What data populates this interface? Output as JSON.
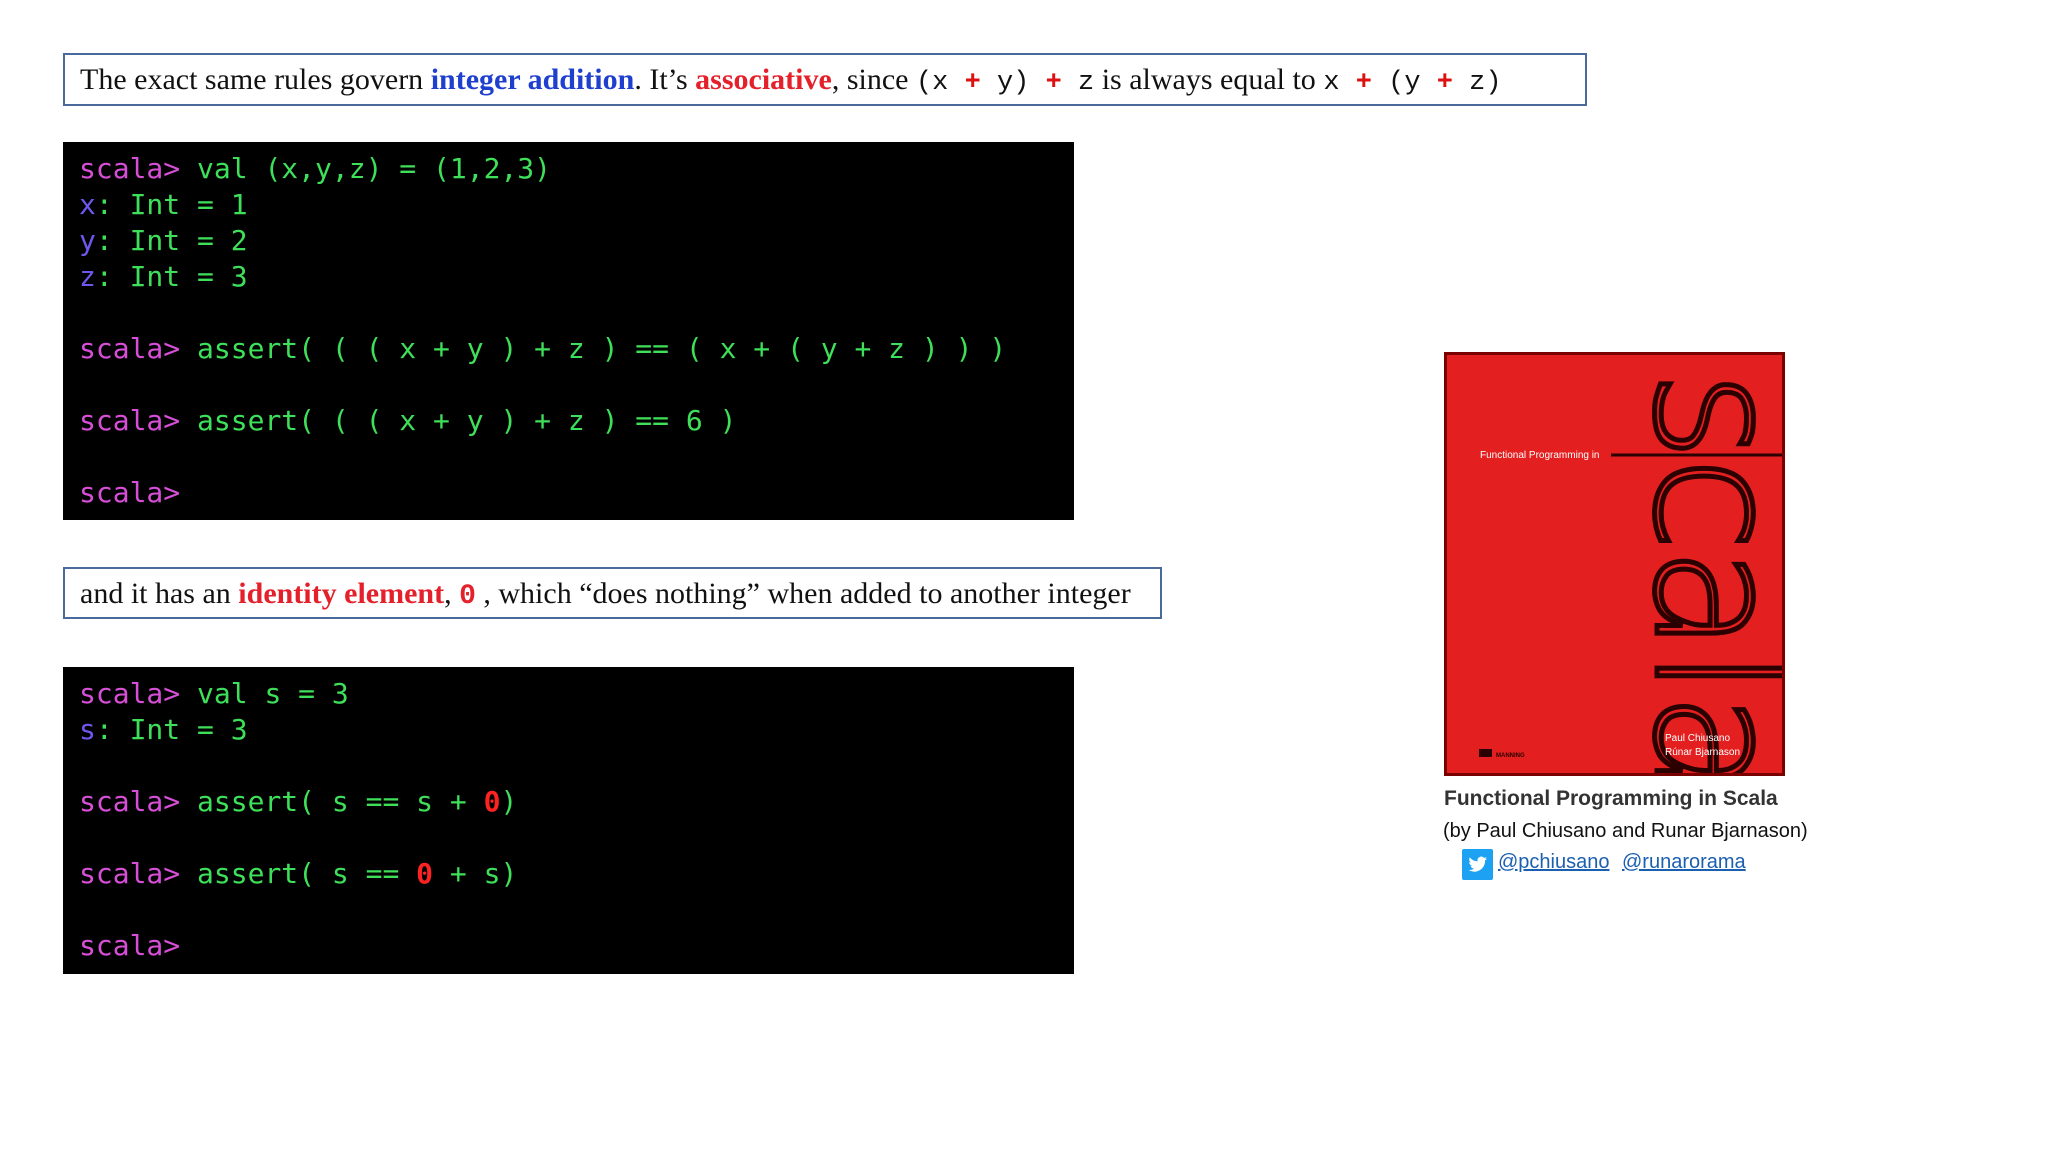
{
  "callout_associative": {
    "t1": "The exact same rules govern ",
    "integer_addition": "integer addition",
    "t2": ". It’s ",
    "associative": "associative",
    "t3": ", since ",
    "expr1_a": "(x ",
    "plus": "+",
    "expr1_b": " y) ",
    "expr1_c": " z",
    "t4": "  is always equal to ",
    "expr2_a": "x ",
    "expr2_b": " (y ",
    "expr2_c": " z)"
  },
  "terminal1": {
    "prompt": "scala>",
    "line1": " val (x,y,z) = (1,2,3)",
    "x_name": "x",
    "x_rest": ": Int = 1",
    "y_name": "y",
    "y_rest": ": Int = 2",
    "z_name": "z",
    "z_rest": ": Int = 3",
    "assert1": " assert( ( ( x + y ) + z ) == ( x + ( y + z ) ) )",
    "assert2": " assert( ( ( x + y ) + z ) == 6 )"
  },
  "callout_identity": {
    "t1": "and it has an ",
    "identity_element": "identity element",
    "t2": ", ",
    "zero": "0",
    "t3": " , which “does nothing” when added to another integer"
  },
  "terminal2": {
    "prompt": "scala>",
    "line1": " val s = 3",
    "s_name": "s",
    "s_rest": ": Int = 3",
    "assert1_a": " assert( s == s + ",
    "zero": "0",
    "assert1_b": ")",
    "assert2_a": " assert( s == ",
    "assert2_b": " + s)"
  },
  "book": {
    "cover_subtitle": "Functional Programming in",
    "cover_word": "scala",
    "cover_author1": "Paul Chiusano",
    "cover_author2": "Rúnar Bjarnason",
    "cover_publisher": "MANNING",
    "title": "Functional Programming in Scala",
    "authors": "(by Paul Chiusano and Runar Bjarnason)",
    "twitter_handle1": "@pchiusano",
    "twitter_handle2": "@runarorama"
  },
  "colors": {
    "blue_keyword": "#1f3fcf",
    "red_keyword": "#e4202a",
    "prompt": "#d64fd6",
    "code_green": "#3ee05a",
    "var_purple": "#6f57ee",
    "cover_red": "#e41f1f"
  }
}
